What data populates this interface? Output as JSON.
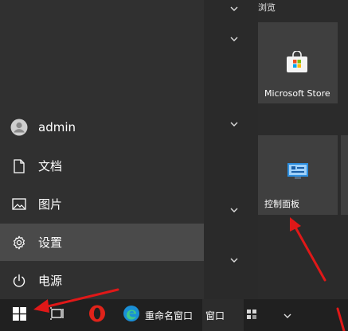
{
  "start_menu": {
    "user": {
      "name": "admin"
    },
    "items": [
      {
        "label": "文档",
        "icon": "document-icon"
      },
      {
        "label": "图片",
        "icon": "picture-icon"
      },
      {
        "label": "设置",
        "icon": "gear-icon",
        "active": true
      },
      {
        "label": "电源",
        "icon": "power-icon"
      }
    ]
  },
  "tiles": {
    "group_label": "浏览",
    "items": [
      {
        "label": "Microsoft Store",
        "icon": "store-icon"
      },
      {
        "label": "控制面板",
        "icon": "control-panel-icon"
      }
    ]
  },
  "taskbar": {
    "items": [
      {
        "label": "重命名窗口"
      },
      {
        "label": "窗口"
      }
    ]
  },
  "colors": {
    "annotation_arrow": "#e01818",
    "opera_red": "#e0231a",
    "edge_blue": "#1a8fd6"
  }
}
